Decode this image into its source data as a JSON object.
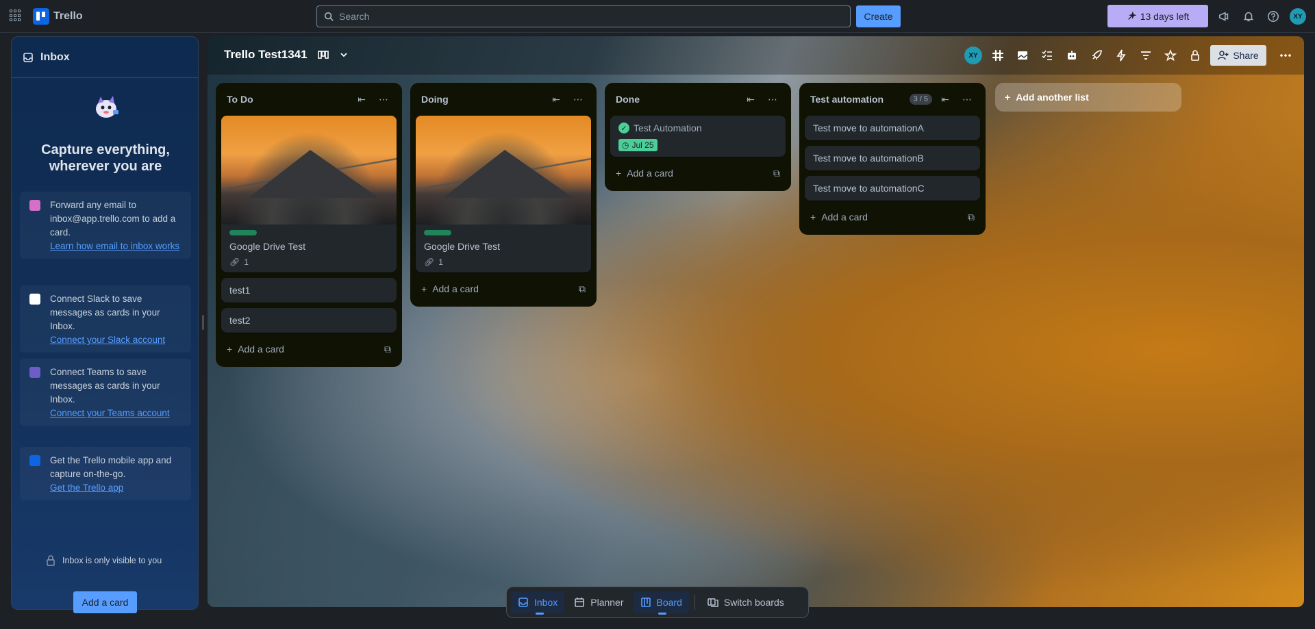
{
  "topbar": {
    "app_name": "Trello",
    "search_placeholder": "Search",
    "create_label": "Create",
    "trial_label": "13 days left",
    "avatar_initials": "XY"
  },
  "inbox": {
    "title": "Inbox",
    "heading": "Capture everything, wherever you are",
    "tips": [
      {
        "text": "Forward any email to inbox@app.trello.com to add a card.",
        "link": "Learn how email to inbox works",
        "icon": "email-icon",
        "color": "#d56fc9"
      },
      {
        "text": "Connect Slack to save messages as cards in your Inbox.",
        "link": "Connect your Slack account",
        "icon": "slack-icon",
        "color": "#e2b203"
      },
      {
        "text": "Connect Teams to save messages as cards in your Inbox.",
        "link": "Connect your Teams account",
        "icon": "teams-icon",
        "color": "#6e5dc6"
      },
      {
        "text": "Get the Trello mobile app and capture on-the-go.",
        "link": "Get the Trello app",
        "icon": "mobile-app-icon",
        "color": "#0c66e4"
      }
    ],
    "private_note": "Inbox is only visible to you",
    "add_card_label": "Add a card"
  },
  "board": {
    "title": "Trello Test1341",
    "avatar_initials": "XY",
    "share_label": "Share",
    "add_list_label": "Add another list",
    "lists": [
      {
        "title": "To Do",
        "cards": [
          {
            "title": "Google Drive Test",
            "cover": true,
            "label": "green",
            "attachments": "1"
          },
          {
            "title": "test1"
          },
          {
            "title": "test2"
          }
        ],
        "add_label": "Add a card"
      },
      {
        "title": "Doing",
        "cards": [
          {
            "title": "Google Drive Test",
            "cover": true,
            "label": "green",
            "attachments": "1"
          }
        ],
        "add_label": "Add a card"
      },
      {
        "title": "Done",
        "cards": [
          {
            "title": "Test Automation",
            "completed": true,
            "due": "Jul 25"
          }
        ],
        "add_label": "Add a card"
      },
      {
        "title": "Test automation",
        "wip": "3 / 5",
        "cards": [
          {
            "title": "Test move to automationA"
          },
          {
            "title": "Test move to automationB"
          },
          {
            "title": "Test move to automationC"
          }
        ],
        "add_label": "Add a card"
      }
    ]
  },
  "switcher": {
    "inbox": "Inbox",
    "planner": "Planner",
    "board": "Board",
    "switch_boards": "Switch boards"
  },
  "colors": {
    "accent": "#579dff",
    "trial": "#b8acf6",
    "label_green": "#1f845a",
    "due_complete": "#4bce97"
  }
}
